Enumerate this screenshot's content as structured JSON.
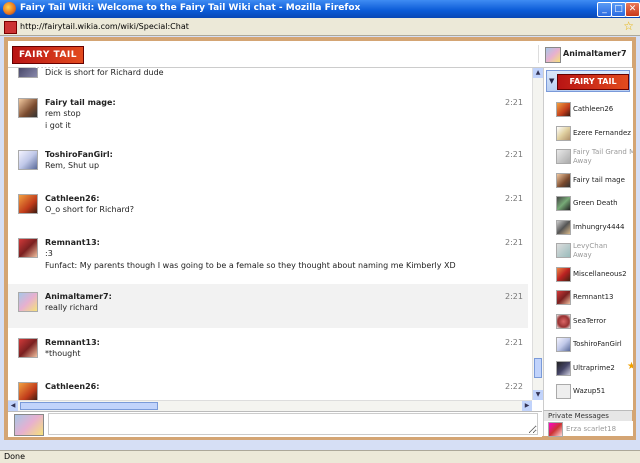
{
  "window": {
    "title": "Fairy Tail Wiki: Welcome to the Fairy Tail Wiki chat - Mozilla Firefox",
    "url": "http://fairytail.wikia.com/wiki/Special:Chat",
    "status": "Done"
  },
  "header": {
    "logo_text": "FAIRY TAIL WIKI",
    "current_user": "Animaltamer7"
  },
  "messages": [
    {
      "user": "",
      "lines": [
        "Dick is short for Richard dude"
      ],
      "time": "",
      "avatar": "av-dick",
      "partial": true
    },
    {
      "user": "Fairy tail mage:",
      "lines": [
        "rem stop",
        "i got it"
      ],
      "time": "2:21",
      "avatar": "av-fairy"
    },
    {
      "user": "ToshiroFanGirl:",
      "lines": [
        "Rem, Shut up"
      ],
      "time": "2:21",
      "avatar": "av-toshiro"
    },
    {
      "user": "Cathleen26:",
      "lines": [
        "O_o short for Richard?"
      ],
      "time": "2:21",
      "avatar": "av-cath"
    },
    {
      "user": "Remnant13:",
      "lines": [
        ":3",
        "Funfact: My parents though I was going to be a female so they thought about naming me Kimberly XD"
      ],
      "time": "2:21",
      "avatar": "av-rem"
    },
    {
      "user": "Animaltamer7:",
      "lines": [
        "really richard"
      ],
      "time": "2:21",
      "avatar": "av-anim",
      "highlight": true
    },
    {
      "user": "Remnant13:",
      "lines": [
        "*thought"
      ],
      "time": "2:21",
      "avatar": "av-rem"
    },
    {
      "user": "Cathleen26:",
      "lines": [],
      "time": "2:22",
      "avatar": "av-cath"
    }
  ],
  "userlist": {
    "room_logo": "FAIRY TAIL WIKI",
    "users": [
      {
        "name": "Cathleen26",
        "avatar": "av-cath"
      },
      {
        "name": "Ezere Fernandez",
        "avatar": "av-ezere"
      },
      {
        "name": "Fairy Tail Grand M",
        "away": "Away",
        "avatar": "av-grand"
      },
      {
        "name": "Fairy tail mage",
        "avatar": "av-fairy"
      },
      {
        "name": "Green Death",
        "avatar": "av-green"
      },
      {
        "name": "Imhungry4444",
        "avatar": "av-imh"
      },
      {
        "name": "LevyChan",
        "away": "Away",
        "avatar": "av-levy"
      },
      {
        "name": "Miscellaneous2",
        "avatar": "av-misc"
      },
      {
        "name": "Remnant13",
        "avatar": "av-rem"
      },
      {
        "name": "SeaTerror",
        "avatar": "av-sea"
      },
      {
        "name": "ToshiroFanGirl",
        "avatar": "av-toshiro"
      },
      {
        "name": "Ultraprime2",
        "avatar": "av-ultra",
        "staff": "★"
      },
      {
        "name": "Wazup51",
        "avatar": "av-waz"
      }
    ],
    "private_messages_label": "Private Messages",
    "private_user": "Erza scarlet18"
  },
  "input": {
    "placeholder": ""
  },
  "glyphs": {
    "minimize": "_",
    "maximize": "□",
    "close": "✕",
    "star": "☆",
    "room_arrow": "▼",
    "up": "▲",
    "down": "▼",
    "left": "◀",
    "right": "▶"
  }
}
